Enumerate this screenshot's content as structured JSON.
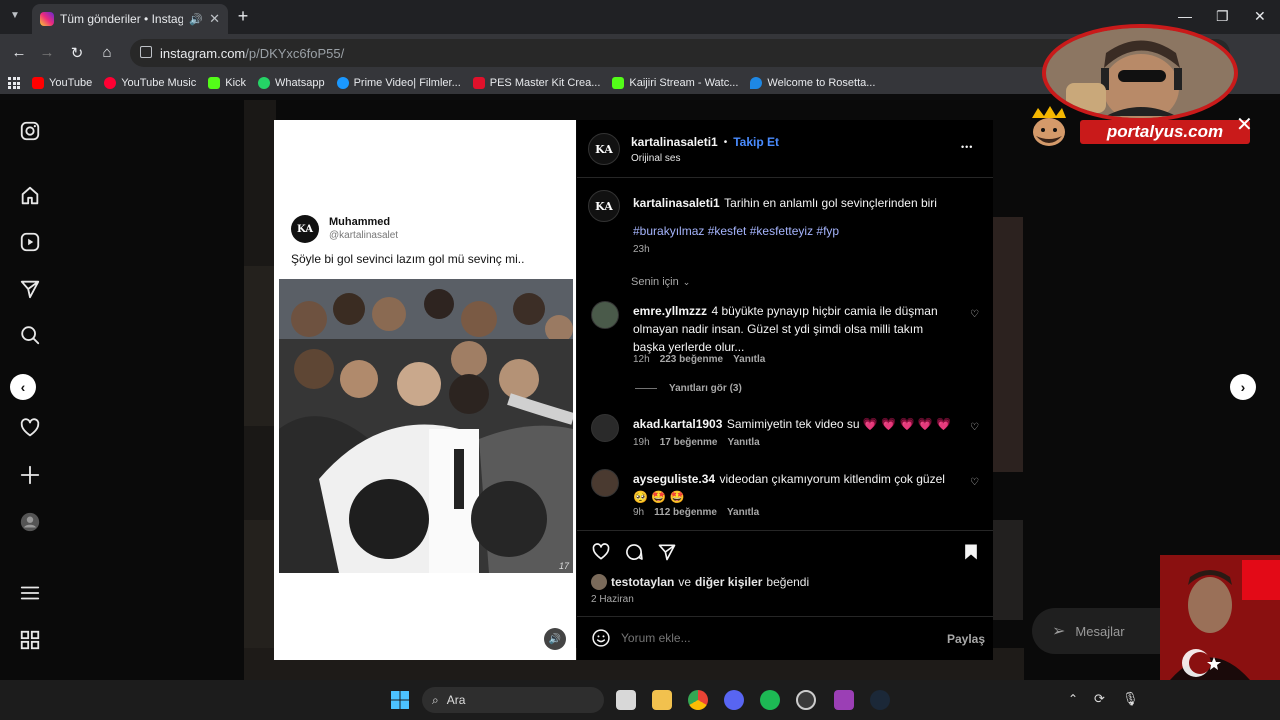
{
  "browser": {
    "tab_title": "Tüm gönderiler • Instagram",
    "tab_close": "✕",
    "new_tab": "+",
    "url_host": "instagram.com",
    "url_path": "/p/DKYxc6foP55/"
  },
  "bookmarks": [
    {
      "label": "YouTube",
      "color": "#ff0000"
    },
    {
      "label": "YouTube Music",
      "color": "#ff0033"
    },
    {
      "label": "Kick",
      "color": "#53fc18"
    },
    {
      "label": "Whatsapp",
      "color": "#25d366"
    },
    {
      "label": "Prime Video| Filmler...",
      "color": "#1a98ff"
    },
    {
      "label": "PES Master Kit Crea...",
      "color": "#e0112b"
    },
    {
      "label": "Kaijiri Stream - Watc...",
      "color": "#53fc18"
    },
    {
      "label": "Welcome to Rosetta...",
      "color": "#1e88e5"
    }
  ],
  "post_image": {
    "author_name": "Muhammed",
    "author_handle": "@kartalinasalet",
    "avatar_text": "KA",
    "caption": "Şöyle bi gol sevinci lazım gol mü sevinç mi..",
    "video_counter": "17"
  },
  "post_header": {
    "username": "kartalinasaleti1",
    "separator": "•",
    "follow_label": "Takip Et",
    "audio_label": "Orijinal ses",
    "more": "•••"
  },
  "caption": {
    "username": "kartalinasaleti1",
    "text": "Tarihin en anlamlı gol sevinçlerinden biri",
    "hashtags": "#burakyılmaz #kesfet #kesfetteyiz #fyp",
    "time": "23h"
  },
  "sort_label": "Senin için",
  "comments": [
    {
      "username": "emre.yllmzzz",
      "text": "4 büyükte pynayıp hiçbir camia ile düşman olmayan nadir insan. Güzel st ydi şimdi olsa milli takım başka yerlerde olur...",
      "time": "12h",
      "likes": "223 beğenme",
      "reply": "Yanıtla"
    },
    {
      "username": "akad.kartal1903",
      "text": "Samimiyetin tek video su 💗 💗 💗 💗 💗",
      "time": "19h",
      "likes": "17 beğenme",
      "reply": "Yanıtla"
    },
    {
      "username": "ayseguliste.34",
      "text": "videodan çıkamıyorum kitlendim çok güzel🥺 🤩 🤩",
      "time": "9h",
      "likes": "112 beğenme",
      "reply": "Yanıtla"
    }
  ],
  "view_replies": "Yanıtları gör (3)",
  "likes_line": {
    "user": "testotaylan",
    "connector": "ve",
    "others": "diğer kişiler",
    "suffix": "beğendi"
  },
  "post_date": "2 Haziran",
  "comment_input": {
    "placeholder": "Yorum ekle...",
    "share_label": "Paylaş"
  },
  "messages_label": "Mesajlar",
  "overlay_brand": "portalyus.com",
  "taskbar": {
    "search_label": "Ara"
  },
  "colors": {
    "accent_link": "#a5b4fc",
    "follow_blue": "#4a8cff",
    "brand_red": "#c91a1a"
  }
}
